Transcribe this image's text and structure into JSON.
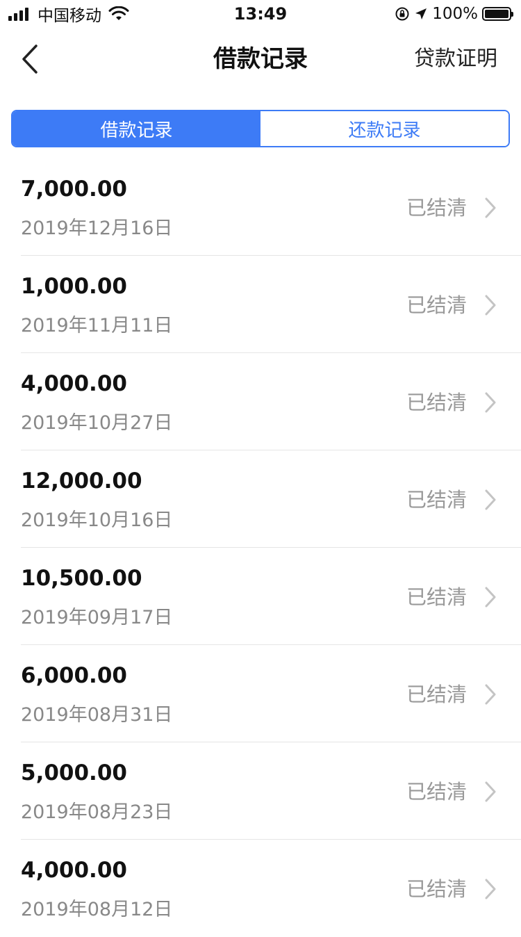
{
  "status_bar": {
    "carrier": "中国移动",
    "time": "13:49",
    "battery_percent": "100%"
  },
  "nav": {
    "title": "借款记录",
    "right_action": "贷款证明"
  },
  "tabs": [
    {
      "label": "借款记录",
      "active": true
    },
    {
      "label": "还款记录",
      "active": false
    }
  ],
  "records": [
    {
      "amount": "7,000.00",
      "date": "2019年12月16日",
      "status": "已结清"
    },
    {
      "amount": "1,000.00",
      "date": "2019年11月11日",
      "status": "已结清"
    },
    {
      "amount": "4,000.00",
      "date": "2019年10月27日",
      "status": "已结清"
    },
    {
      "amount": "12,000.00",
      "date": "2019年10月16日",
      "status": "已结清"
    },
    {
      "amount": "10,500.00",
      "date": "2019年09月17日",
      "status": "已结清"
    },
    {
      "amount": "6,000.00",
      "date": "2019年08月31日",
      "status": "已结清"
    },
    {
      "amount": "5,000.00",
      "date": "2019年08月23日",
      "status": "已结清"
    },
    {
      "amount": "4,000.00",
      "date": "2019年08月12日",
      "status": "已结清"
    }
  ],
  "colors": {
    "accent": "#3d7bf6",
    "status_gray": "#999999",
    "date_gray": "#888888"
  },
  "icons": {
    "back": "chevron-left-icon",
    "row_arrow": "chevron-right-icon",
    "signal": "signal-icon",
    "wifi": "wifi-icon",
    "orientation_lock": "orientation-lock-icon",
    "location": "location-arrow-icon",
    "battery": "battery-icon"
  }
}
